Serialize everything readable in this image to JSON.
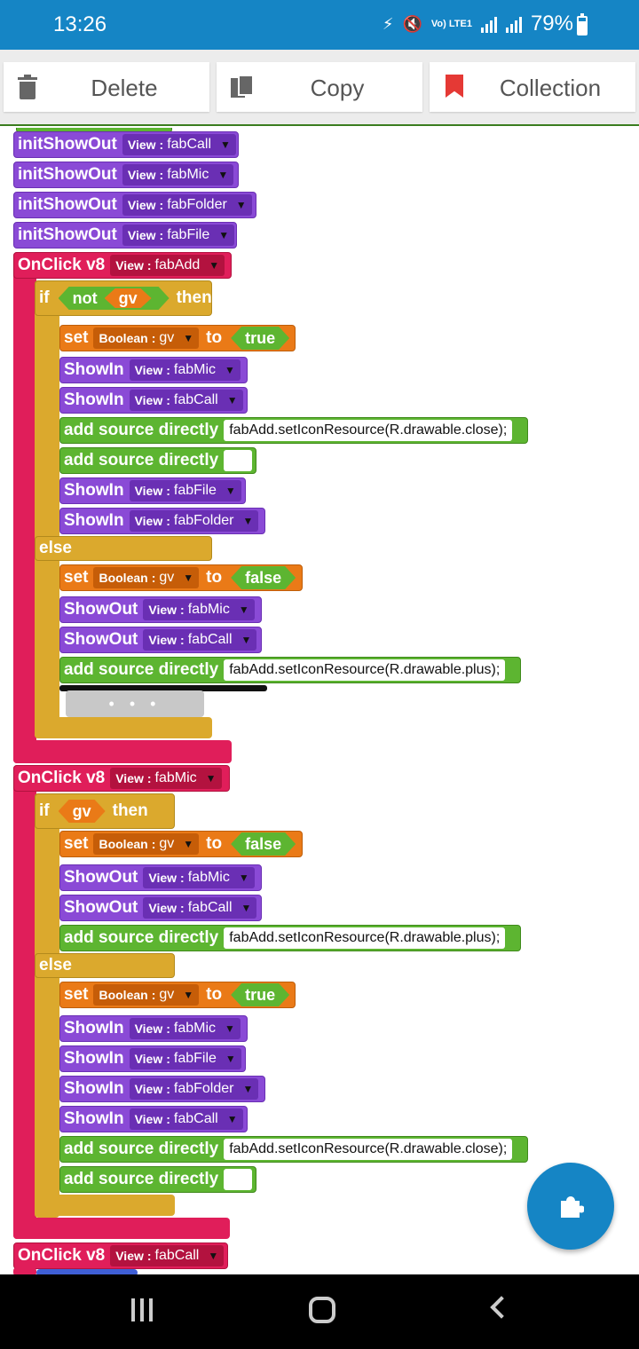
{
  "status_bar": {
    "time": "13:26",
    "network": "Vo) LTE1",
    "battery": "79%"
  },
  "toolbar": {
    "delete_label": "Delete",
    "copy_label": "Copy",
    "collection_label": "Collection"
  },
  "labels": {
    "view": "View",
    "boolean": "Boolean",
    "colon": ":",
    "arrow": "▼",
    "init_show_out": "initShowOut",
    "onclick": "OnClick v8",
    "if": "if",
    "not": "not",
    "then": "then",
    "else": "else",
    "set": "set",
    "to": "to",
    "show_in": "ShowIn",
    "show_out": "ShowOut",
    "add_source": "add source directly",
    "true": "true",
    "false": "false",
    "gv": "gv",
    "ghost_dots": "• • •"
  },
  "blocks": {
    "init": [
      "fabCall",
      "fabMic",
      "fabFolder",
      "fabFile"
    ],
    "onclick_add": {
      "view": "fabAdd",
      "then": {
        "set_value": "true",
        "stmts": [
          "fabMic",
          "fabCall",
          "fabAdd.setIconResource(R.drawable.close);",
          "",
          "fabFile",
          "fabFolder"
        ]
      },
      "else": {
        "set_value": "false",
        "stmts": [
          "fabMic",
          "fabCall",
          "fabAdd.setIconResource(R.drawable.plus);"
        ]
      }
    },
    "onclick_mic": {
      "view": "fabMic",
      "then": {
        "set_value": "false",
        "stmts": [
          "fabMic",
          "fabCall",
          "fabAdd.setIconResource(R.drawable.plus);"
        ]
      },
      "else": {
        "set_value": "true",
        "stmts": [
          "fabMic",
          "fabFile",
          "fabFolder",
          "fabCall",
          "fabAdd.setIconResource(R.drawable.close);",
          ""
        ]
      }
    },
    "onclick_call": {
      "view": "fabCall"
    }
  },
  "colors": {
    "primary": "#1585C5",
    "purple": "#8A4AD6",
    "green": "#5DB531",
    "orange": "#EA7A17",
    "magenta": "#E01E5A",
    "gold": "#DBA92D"
  },
  "icons": {
    "delete": "trash-icon",
    "copy": "copy-icon",
    "collection": "bookmark-icon",
    "fab": "puzzle-icon",
    "nav": [
      "recent-apps-icon",
      "home-icon",
      "back-icon"
    ]
  }
}
